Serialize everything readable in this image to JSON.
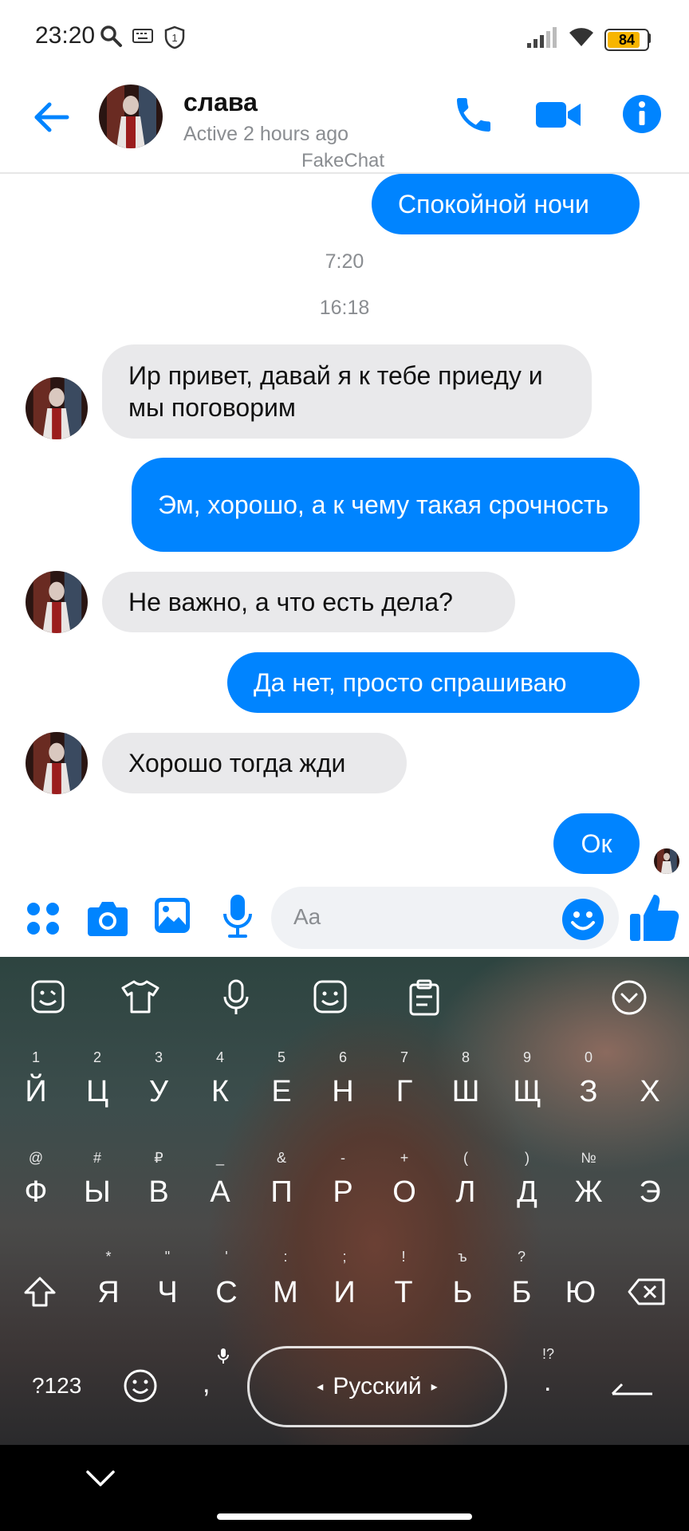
{
  "status_bar": {
    "time": "23:20",
    "battery": "84",
    "battery_level_percent": 84,
    "icons": [
      "search-icon",
      "keyboard-icon",
      "shield-icon",
      "signal-icon",
      "wifi-icon",
      "battery-icon"
    ]
  },
  "header": {
    "contact_name": "слава",
    "status": "Active 2 hours ago",
    "watermark": "FakeChat",
    "accent_color": "#0084ff",
    "icons": [
      "back-arrow-icon",
      "phone-icon",
      "video-camera-icon",
      "info-icon"
    ]
  },
  "messages": [
    {
      "dir": "out",
      "text": "Спокойной ночи"
    },
    {
      "type": "time",
      "text": "7:20"
    },
    {
      "type": "time",
      "text": "16:18"
    },
    {
      "dir": "in",
      "text": "Ир привет, давай я к тебе приеду и мы поговорим"
    },
    {
      "dir": "out",
      "text": "Эм, хорошо, а к чему такая срочность"
    },
    {
      "dir": "in",
      "text": "Не важно, а что есть дела?"
    },
    {
      "dir": "out",
      "text": "Да нет, просто спрашиваю"
    },
    {
      "dir": "in",
      "text": "Хорошо тогда жди"
    },
    {
      "dir": "out",
      "text": "Ок"
    }
  ],
  "composer": {
    "placeholder": "Aa",
    "icons": [
      "apps-grid-icon",
      "camera-icon",
      "gallery-icon",
      "microphone-icon",
      "emoji-icon",
      "thumbs-up-icon"
    ]
  },
  "keyboard": {
    "toolbar_icons": [
      "sticker-icon",
      "theme-shirt-icon",
      "voice-input-icon",
      "emoji-icon",
      "clipboard-icon",
      "collapse-icon"
    ],
    "row1": {
      "keys": [
        "Й",
        "Ц",
        "У",
        "К",
        "Е",
        "Н",
        "Г",
        "Ш",
        "Щ",
        "З",
        "Х"
      ],
      "hints": [
        "1",
        "2",
        "3",
        "4",
        "5",
        "6",
        "7",
        "8",
        "9",
        "0",
        ""
      ]
    },
    "row2": {
      "keys": [
        "Ф",
        "Ы",
        "В",
        "А",
        "П",
        "Р",
        "О",
        "Л",
        "Д",
        "Ж",
        "Э"
      ],
      "hints": [
        "@",
        "#",
        "₽",
        "_",
        "&",
        "-",
        "+",
        "(",
        ")",
        "№",
        ""
      ]
    },
    "row3": {
      "keys": [
        "Я",
        "Ч",
        "С",
        "М",
        "И",
        "Т",
        "Ь",
        "Б",
        "Ю"
      ],
      "hints": [
        "*",
        "\"",
        "'",
        ":",
        ";",
        "!",
        "ъ",
        "?",
        ""
      ]
    },
    "sym_label": "?123",
    "comma": ",",
    "space_label": "Русский",
    "period": ".",
    "period_hint": "!?"
  }
}
